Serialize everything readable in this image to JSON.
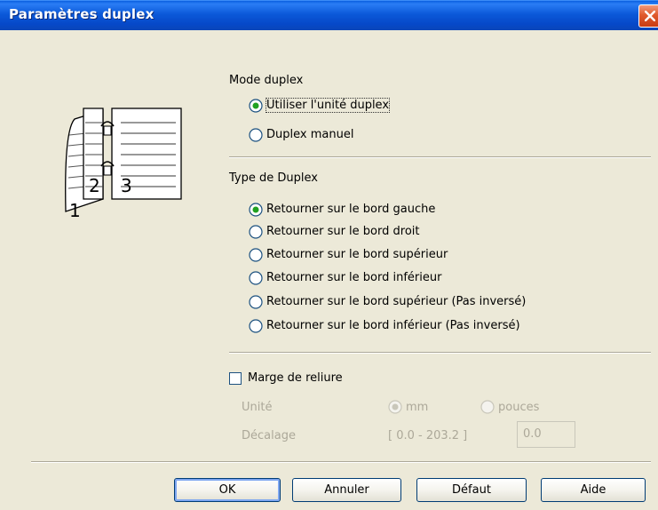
{
  "window": {
    "title": "Paramètres duplex"
  },
  "mode": {
    "title": "Mode duplex",
    "options": [
      {
        "label": "Utiliser l'unité duplex",
        "selected": true
      },
      {
        "label": "Duplex manuel",
        "selected": false
      }
    ]
  },
  "type": {
    "title": "Type de Duplex",
    "options": [
      {
        "label": "Retourner sur le bord gauche",
        "selected": true
      },
      {
        "label": "Retourner sur le bord droit",
        "selected": false
      },
      {
        "label": "Retourner sur le bord supérieur",
        "selected": false
      },
      {
        "label": "Retourner sur le bord inférieur",
        "selected": false
      },
      {
        "label": "Retourner sur le bord supérieur (Pas inversé)",
        "selected": false
      },
      {
        "label": "Retourner sur le bord inférieur (Pas inversé)",
        "selected": false
      }
    ]
  },
  "margin": {
    "checkbox_label": "Marge de reliure",
    "checked": false,
    "unit_label": "Unité",
    "unit_mm": "mm",
    "unit_inches": "pouces",
    "offset_label": "Décalage",
    "range": "[ 0.0 - 203.2 ]",
    "value": "0.0"
  },
  "buttons": {
    "ok": "OK",
    "cancel": "Annuler",
    "default": "Défaut",
    "help": "Aide"
  },
  "preview": {
    "page_numbers": [
      "1",
      "2",
      "3"
    ]
  }
}
